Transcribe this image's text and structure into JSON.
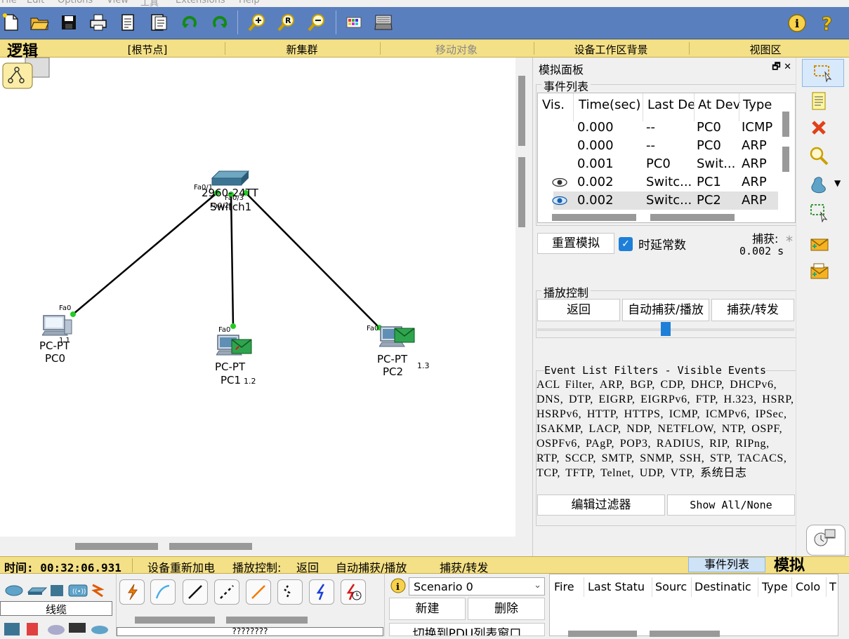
{
  "menu": [
    "File",
    "Edit",
    "Options",
    "View",
    "工具",
    "Extensions",
    "Help"
  ],
  "logic_bar": {
    "title": "逻辑",
    "root": "[根节点]",
    "new_cluster": "新集群",
    "move_object": "移动对象",
    "workspace_bg": "设备工作区背景",
    "viewport": "视图区"
  },
  "topology": {
    "switch": {
      "model": "2960-24TT",
      "name": "Switch1",
      "ports": [
        "Fa0/1",
        "Fa0/2",
        "Fa0/3"
      ]
    },
    "pcs": [
      {
        "type": "PC-PT",
        "name": "PC0",
        "port": "Fa0",
        "ip_suffix": "1.1"
      },
      {
        "type": "PC-PT",
        "name": "PC1",
        "port": "Fa0",
        "ip_suffix": "1.2"
      },
      {
        "type": "PC-PT",
        "name": "PC2",
        "port": "Fa0",
        "ip_suffix": "1.3"
      }
    ]
  },
  "sim_panel": {
    "title": "模拟面板",
    "event_list_label": "事件列表",
    "columns": [
      "Vis.",
      "Time(sec)",
      "Last De",
      "At Dev",
      "Type"
    ],
    "events": [
      {
        "vis": "",
        "time": "0.000",
        "last": "--",
        "at": "PC0",
        "type": "ICMP"
      },
      {
        "vis": "",
        "time": "0.000",
        "last": "--",
        "at": "PC0",
        "type": "ARP"
      },
      {
        "vis": "",
        "time": "0.001",
        "last": "PC0",
        "at": "Swit...",
        "type": "ARP"
      },
      {
        "vis": "eye",
        "time": "0.002",
        "last": "Switc...",
        "at": "PC1",
        "type": "ARP"
      },
      {
        "vis": "eye",
        "time": "0.002",
        "last": "Switc...",
        "at": "PC2",
        "type": "ARP"
      }
    ],
    "reset_button": "重置模拟",
    "constant_delay_label": "时延常数",
    "constant_delay_checked": true,
    "captured_label": "捕获:",
    "captured_value": "0.002 s",
    "playback_label": "播放控制",
    "back_button": "返回",
    "auto_button": "自动捕获/播放",
    "capture_button": "捕获/转发",
    "slider_value": 0.5,
    "filters_title": "Event List Filters - Visible Events",
    "filters_text": "ACL Filter, ARP, BGP, CDP, DHCP, DHCPv6, DNS, DTP, EIGRP, EIGRPv6, FTP, H.323, HSRP, HSRPv6, HTTP, HTTPS, ICMP, ICMPv6, IPSec, ISAKMP, LACP, NDP, NETFLOW, NTP, OSPF, OSPFv6, PAgP, POP3, RADIUS, RIP, RIPng, RTP, SCCP, SMTP, SNMP, SSH, STP, TACACS, TCP, TFTP, Telnet, UDP, VTP, 系统日志",
    "edit_filters_button": "编辑过滤器",
    "show_all_button": "Show All/None"
  },
  "status_bar": {
    "time": "时间: 00:32:06.931",
    "power_cycle": "设备重新加电",
    "playback": "播放控制:",
    "back": "返回",
    "auto": "自动捕获/播放",
    "capture": "捕获/转发",
    "event_list_tab": "事件列表",
    "mode": "模拟"
  },
  "bottom": {
    "device_category": "线缆",
    "device_model": "????????",
    "scenario": "Scenario 0",
    "new_button": "新建",
    "delete_button": "删除",
    "switch_pdu": "切换到PDU列表窗口",
    "pdu_columns": [
      "Fire",
      "Last Statu",
      "Sourc",
      "Destinatic",
      "Type",
      "Colo",
      "T"
    ]
  },
  "colors": {
    "toolbar": "#5a7fbe",
    "logic_bar": "#f4e086",
    "link": "#000000",
    "port_up": "#22cc22",
    "selection": "#1e7fd8"
  }
}
